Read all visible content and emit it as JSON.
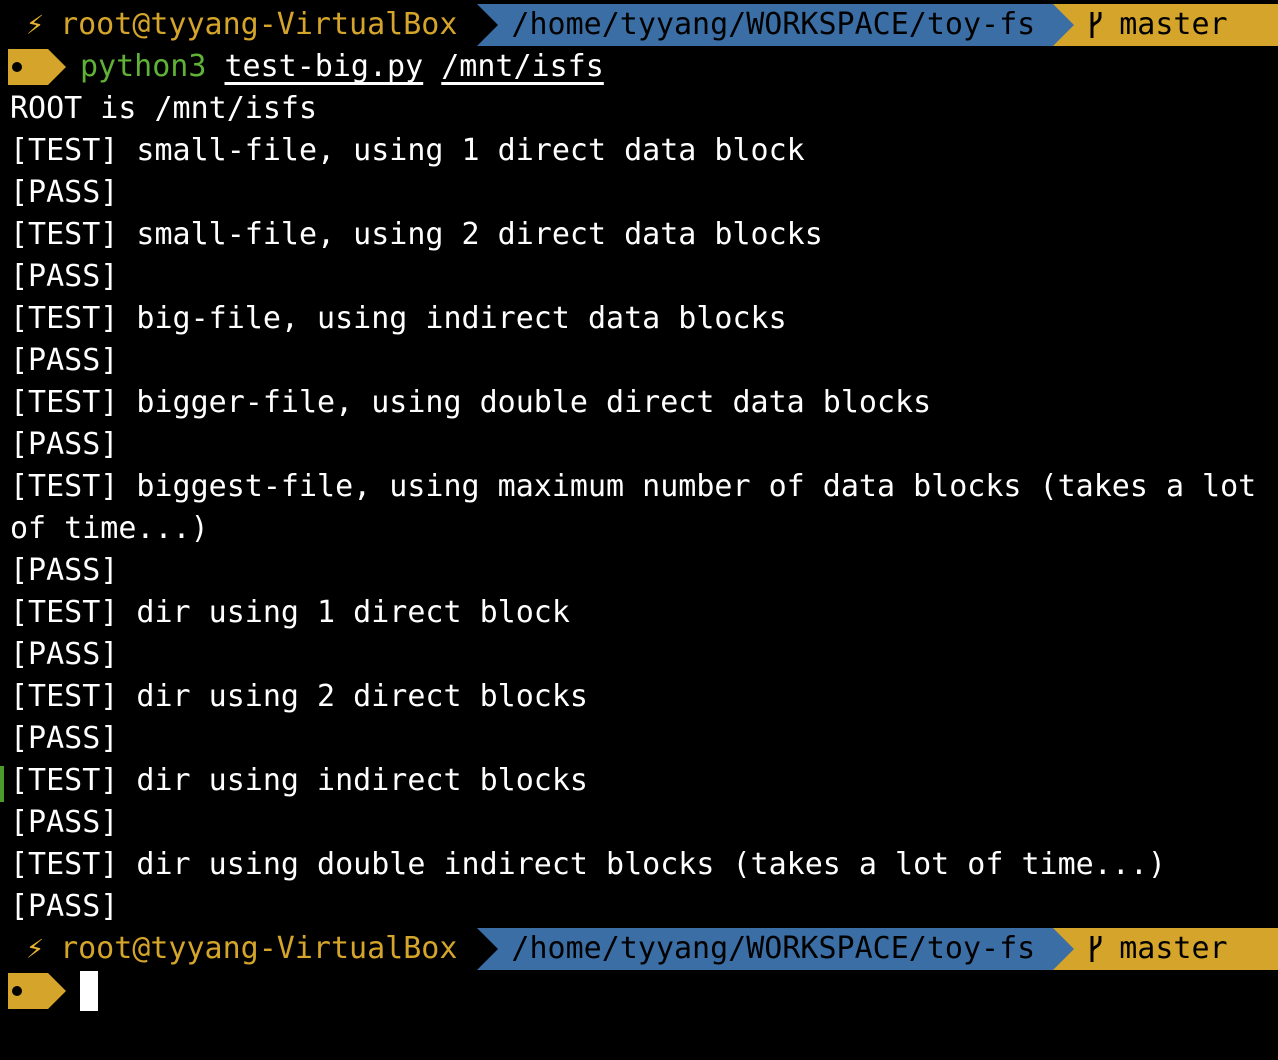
{
  "prompt": {
    "bolt": "⚡",
    "user_host": "root@tyyang-VirtualBox",
    "cwd": "/home/tyyang/WORKSPACE/toy-fs",
    "branch_icon": "git-branch-icon",
    "branch": "master"
  },
  "command": {
    "name": "python3",
    "script": "test-big.py",
    "arg": "/mnt/isfs"
  },
  "output": [
    "ROOT is /mnt/isfs",
    "[TEST] small-file, using 1 direct data block",
    "[PASS]",
    "[TEST] small-file, using 2 direct data blocks",
    "[PASS]",
    "[TEST] big-file, using indirect data blocks",
    "[PASS]",
    "[TEST] bigger-file, using double direct data blocks",
    "[PASS]",
    "[TEST] biggest-file, using maximum number of data blocks (takes a lot",
    "of time...)",
    "[PASS]",
    "[TEST] dir using 1 direct block",
    "[PASS]",
    "[TEST] dir using 2 direct blocks",
    "[PASS]",
    "[TEST] dir using indirect blocks",
    "[PASS]",
    "[TEST] dir using double indirect blocks (takes a lot of time...)",
    "[PASS]"
  ],
  "colors": {
    "background": "#000000",
    "user_host": "#d4a52a",
    "dir_segment": "#3a6ea5",
    "git_segment": "#d4a52a",
    "command": "#5fb236",
    "text": "#ffffff"
  }
}
